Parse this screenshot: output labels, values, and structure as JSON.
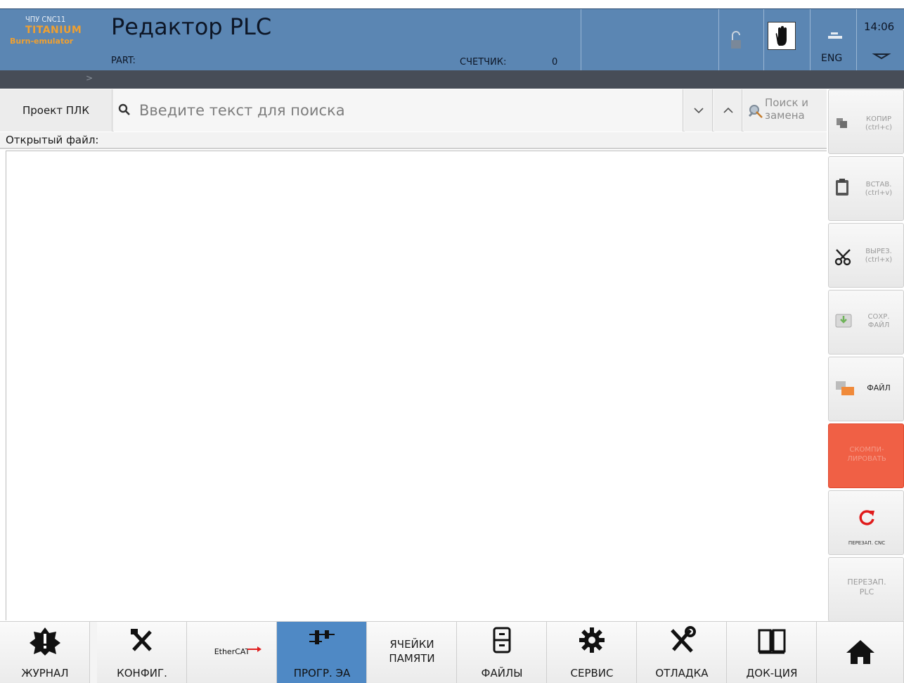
{
  "header": {
    "brand_line1": "ЧПУ CNC11",
    "brand_line2": "TITANIUM",
    "brand_line3": "Burn-emulator",
    "title": "Редактор PLC",
    "part_label": "PART:",
    "counter_label": "СЧЕТЧИК:",
    "counter_value": "0",
    "language": "ENG",
    "time": "14:06",
    "lock_icon": "lock-open-icon",
    "hand_icon": "hand-icon",
    "keyboard_icon": "keyboard-icon",
    "dropdown_icon": "chevron-down-icon",
    "darkbar_arrow": ">",
    "colors": {
      "header_bg": "#5b86b3",
      "brand_orange": "#f0a030",
      "darkbar": "#474d57"
    }
  },
  "toolbar": {
    "project_button": "Проект ПЛК",
    "search_placeholder": "Введите текст для поиска",
    "search_prev_icon": "chevron-down-icon",
    "search_next_icon": "chevron-up-icon",
    "replace_label_line1": "Поиск и",
    "replace_label_line2": "замена"
  },
  "file": {
    "open_file_label": "Открытый файл:"
  },
  "side": {
    "copy": {
      "label1": "КОПИР",
      "label2": "(ctrl+c)"
    },
    "paste": {
      "label1": "ВСТАВ.",
      "label2": "(ctrl+v)"
    },
    "cut": {
      "label1": "ВЫРЕЗ.",
      "label2": "(ctrl+x)"
    },
    "save": {
      "label1": "СОХР.",
      "label2": "ФАЙЛ"
    },
    "file": {
      "label1": "ФАЙЛ"
    },
    "compile": {
      "label1": "СКОМПИ-",
      "label2": "ЛИРОВАТЬ"
    },
    "restart_cnc": {
      "label1": "ПЕРЕЗАП. CNC"
    },
    "restart_plc": {
      "label1": "ПЕРЕЗАП.",
      "label2": "PLC"
    },
    "colors": {
      "compile_red": "#f06045",
      "restart_icon": "#e01a1a"
    }
  },
  "bottom_nav": {
    "journal": "ЖУРНАЛ",
    "config": "КОНФИГ.",
    "ethercat_logo": "EtherCAT",
    "prog": "ПРОГР. ЭА",
    "memory_line1": "ЯЧЕЙКИ",
    "memory_line2": "ПАМЯТИ",
    "files": "ФАЙЛЫ",
    "service": "СЕРВИС",
    "debug": "ОТЛАДКА",
    "docs": "ДОК-ЦИЯ",
    "active_color": "#4f89c5"
  }
}
